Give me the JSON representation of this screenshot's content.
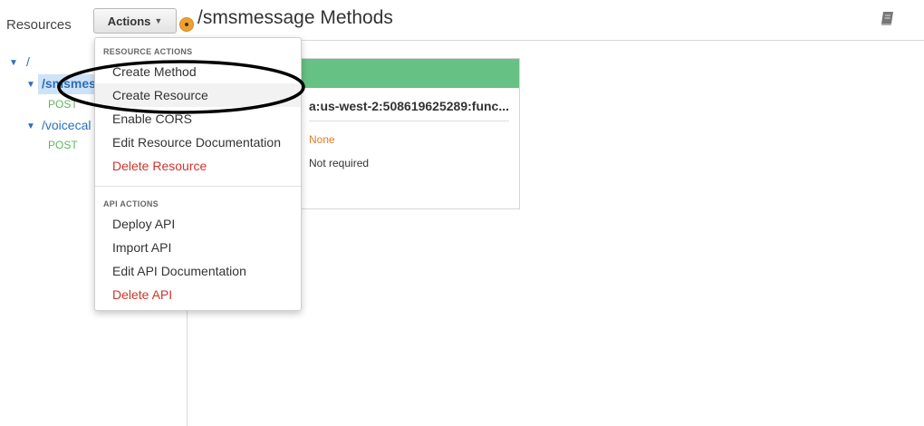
{
  "sidebar": {
    "title": "Resources",
    "tree": [
      {
        "label": "/"
      },
      {
        "label": "/smsmes",
        "method": "POST"
      },
      {
        "label": "/voicecal",
        "method": "POST"
      }
    ]
  },
  "header": {
    "actions_label": "Actions",
    "title": "/smsmessage Methods"
  },
  "method_panel": {
    "lambda_arn": "a:us-west-2:508619625289:func...",
    "authorization": "None",
    "api_key": "Not required",
    "header_color": "#66c184"
  },
  "dropdown": {
    "resource_actions_header": "RESOURCE ACTIONS",
    "resource_actions": [
      {
        "label": "Create Method"
      },
      {
        "label": "Create Resource"
      },
      {
        "label": "Enable CORS"
      },
      {
        "label": "Edit Resource Documentation"
      },
      {
        "label": "Delete Resource"
      }
    ],
    "api_actions_header": "API ACTIONS",
    "api_actions": [
      {
        "label": "Deploy API"
      },
      {
        "label": "Import API"
      },
      {
        "label": "Edit API Documentation"
      },
      {
        "label": "Delete API"
      }
    ]
  },
  "colors": {
    "link": "#2a6ebb",
    "method": "#5cb85c",
    "danger": "#d0342c",
    "accent_orange": "#f0a030"
  },
  "icons": [
    "caret-down-icon",
    "book-icon",
    "help-dot-icon",
    "tree-expand-icon"
  ]
}
